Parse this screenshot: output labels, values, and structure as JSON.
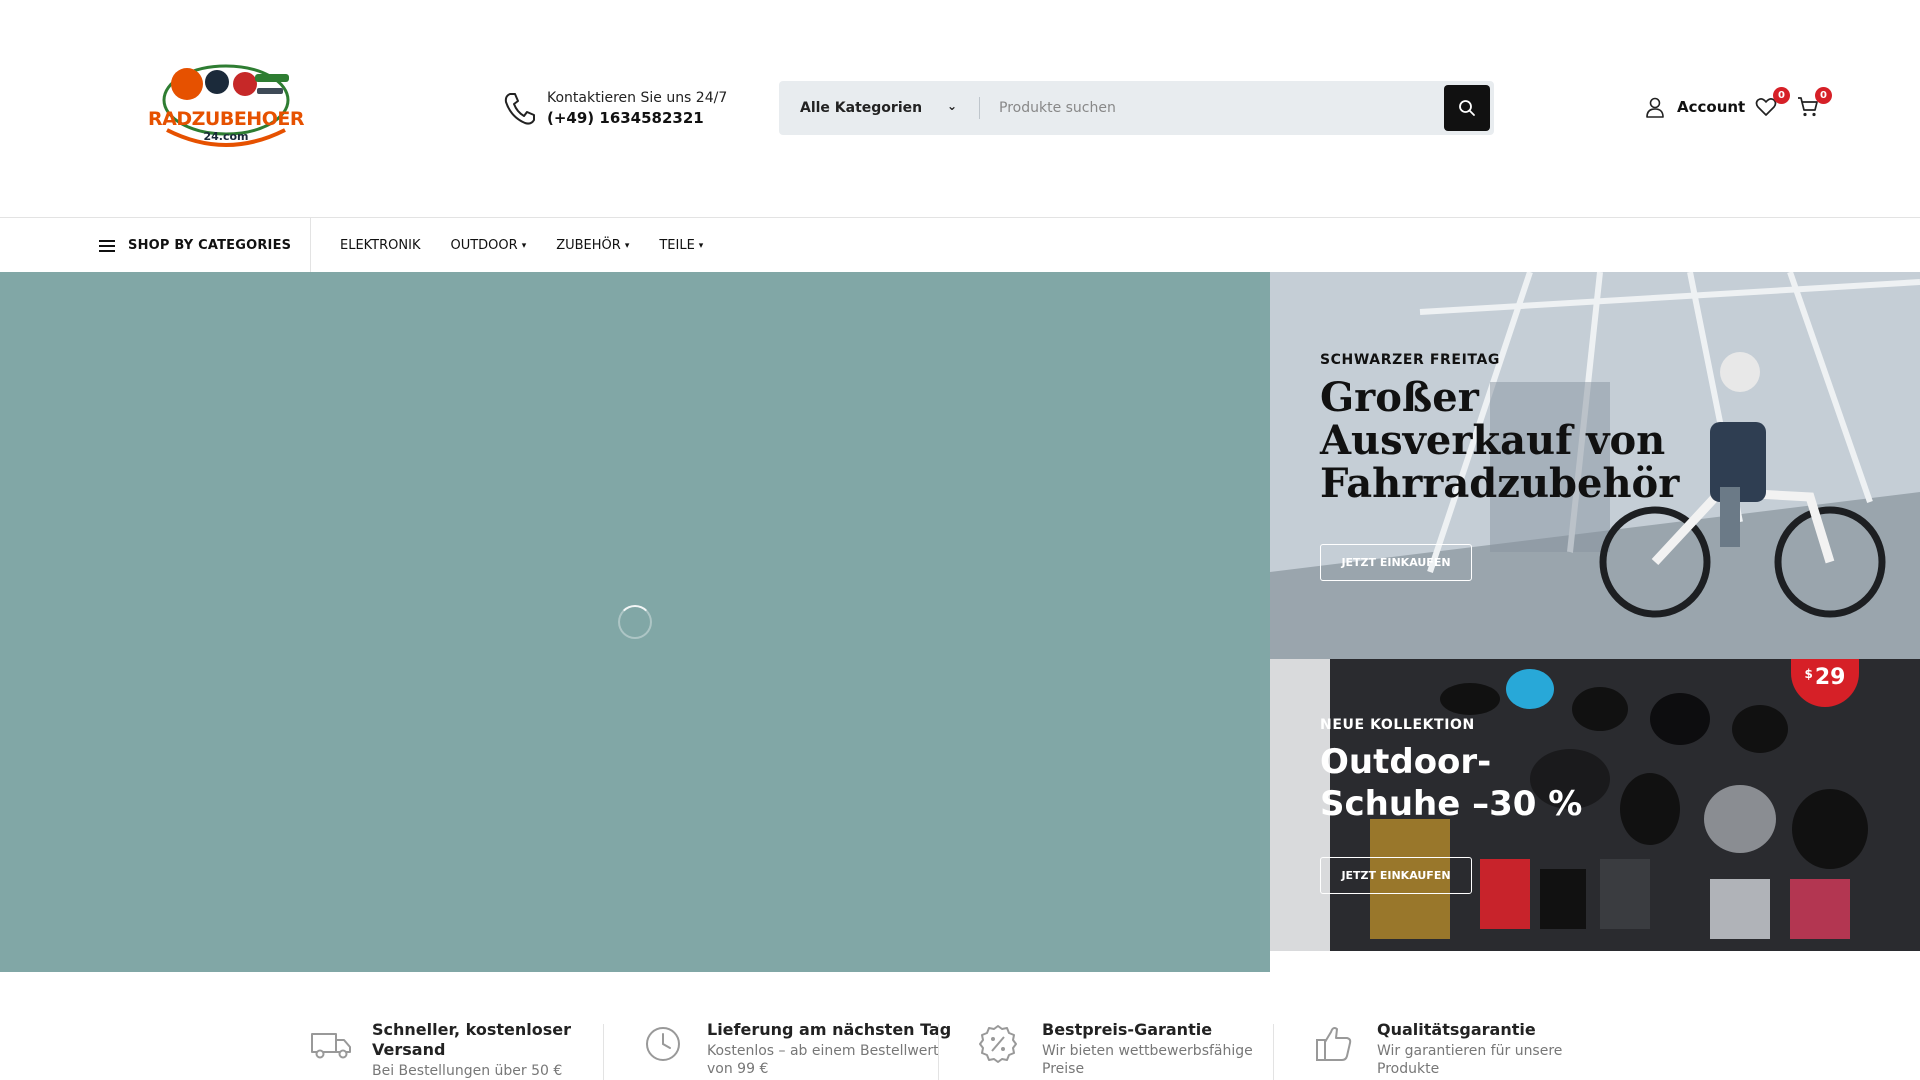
{
  "header": {
    "logo_text": "RADZUBEHOER",
    "logo_subtext": "24.com",
    "contact_label": "Kontaktieren Sie uns 24/7",
    "contact_phone": "(+49) 1634582321",
    "search": {
      "category": "Alle Kategorien",
      "placeholder": "Produkte suchen"
    },
    "account_label": "Account",
    "wishlist_count": "0",
    "cart_count": "0"
  },
  "nav": {
    "shop_by": "SHOP BY CATEGORIES",
    "items": [
      {
        "label": "ELEKTRONIK"
      },
      {
        "label": "OUTDOOR"
      },
      {
        "label": "ZUBEHÖR"
      },
      {
        "label": "TEILE"
      }
    ]
  },
  "banners": [
    {
      "label": "SCHWARZER FREITAG",
      "title_line1": "Großer",
      "title_line2": "Ausverkauf von",
      "title_line3": "Fahrradzubehör",
      "button": "JETZT EINKAUFEN"
    },
    {
      "label": "NEUE KOLLEKTION",
      "title_line1": "Outdoor-",
      "title_line2": "Schuhe –30 %",
      "button": "JETZT EINKAUFEN",
      "price_currency": "$",
      "price_amount": "29"
    }
  ],
  "features": [
    {
      "title_line1": "Schneller, kostenloser",
      "title_line2": "Versand",
      "text": "Bei Bestellungen über 50 €"
    },
    {
      "title_line1": "Lieferung am nächsten Tag",
      "title_line2": "",
      "text": "Kostenlos – ab einem Bestellwert",
      "text2": "von 99 €"
    },
    {
      "title_line1": "Bestpreis-Garantie",
      "title_line2": "",
      "text": "Wir bieten wettbewerbsfähige",
      "text2": "Preise"
    },
    {
      "title_line1": "Qualitätsgarantie",
      "title_line2": "",
      "text": "Wir garantieren für unsere",
      "text2": "Produkte"
    }
  ],
  "colors": {
    "hero_bg": "#81a7a6",
    "accent_red": "#d62027",
    "search_bg": "#e8ecef"
  }
}
